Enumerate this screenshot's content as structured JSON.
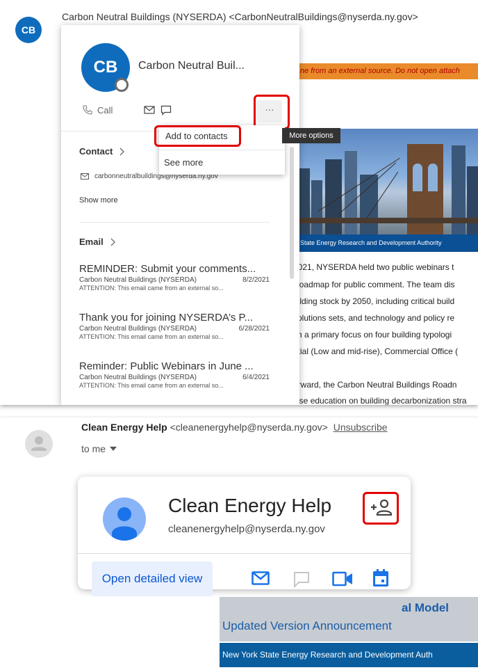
{
  "outlook": {
    "sender_initials": "CB",
    "sender_line": "Carbon Neutral Buildings (NYSERDA) <CarbonNeutralBuildings@nyserda.ny.gov>",
    "banner_text": "ne from an external source. Do not open attach",
    "photo_caption": "State Energy Research and Development Authority",
    "body_lines": [
      "2021, NYSERDA held two public webinars t",
      "Roadmap for public comment. The team dis",
      "uilding stock by 2050, including critical build",
      "solutions sets, and technology and policy re",
      "ith a primary focus on four building typologi",
      "ntial (Low and mid-rise), Commercial Office (",
      "orward, the Carbon Neutral Buildings Roadn",
      "increase education on building decarbonization stra"
    ],
    "card": {
      "initials": "CB",
      "name": "Carbon Neutral Buil...",
      "call_label": "Call",
      "more_label": "···",
      "contact_heading": "Contact",
      "contact_email": "carbonneutralbuildings@nyserda.ny.gov",
      "show_more": "Show more",
      "email_heading": "Email",
      "emails": [
        {
          "subject": "REMINDER: Submit your comments...",
          "sender": "Carbon Neutral Buildings (NYSERDA)",
          "date": "8/2/2021",
          "preview": "ATTENTION: This email came from an external so..."
        },
        {
          "subject": "Thank you for joining NYSERDA’s P...",
          "sender": "Carbon Neutral Buildings (NYSERDA)",
          "date": "6/28/2021",
          "preview": "ATTENTION: This email came from an external so..."
        },
        {
          "subject": "Reminder: Public Webinars in June ...",
          "sender": "Carbon Neutral Buildings (NYSERDA)",
          "date": "6/4/2021",
          "preview": "ATTENTION: This email came from an external so..."
        }
      ]
    },
    "menu": {
      "add_to_contacts": "Add to contacts",
      "see_more": "See more"
    },
    "tooltip": "More options"
  },
  "gmail": {
    "sender_name": "Clean Energy Help",
    "sender_email": "<cleanenergyhelp@nyserda.ny.gov>",
    "unsubscribe": "Unsubscribe",
    "to_me": "to me",
    "card": {
      "name": "Clean Energy Help",
      "email": "cleanenergyhelp@nyserda.ny.gov",
      "open_detailed_view": "Open detailed view"
    },
    "doc": {
      "title_line1": "al Model",
      "title_line2": "Updated Version Announcement",
      "bar_text": "New York State Energy Research and Development Auth"
    }
  },
  "colors": {
    "highlight": "#e30000",
    "outlook_blue": "#0f6cbd",
    "gmail_blue": "#0b57d0"
  }
}
